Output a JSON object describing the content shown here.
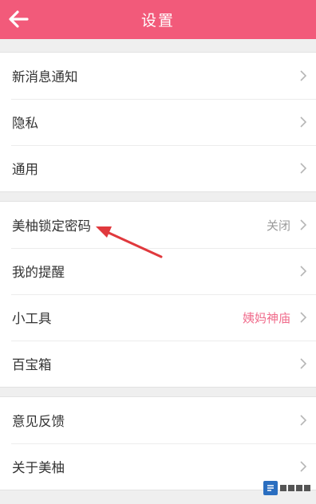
{
  "header": {
    "title": "设置",
    "back_icon": "arrow-left-icon",
    "color": "#f25a7a"
  },
  "group1": {
    "items": [
      {
        "label": "新消息通知"
      },
      {
        "label": "隐私"
      },
      {
        "label": "通用"
      }
    ]
  },
  "group2": {
    "items": [
      {
        "label": "美柚锁定密码",
        "value": "关闭"
      },
      {
        "label": "我的提醒"
      },
      {
        "label": "小工具",
        "value": "姨妈神庙"
      },
      {
        "label": "百宝箱"
      }
    ]
  },
  "group3": {
    "items": [
      {
        "label": "意见反馈"
      },
      {
        "label": "关于美柚"
      }
    ]
  },
  "colors": {
    "accent": "#f25a7a",
    "value_gray": "#9a9a9a",
    "value_pink": "#f06b8b"
  }
}
